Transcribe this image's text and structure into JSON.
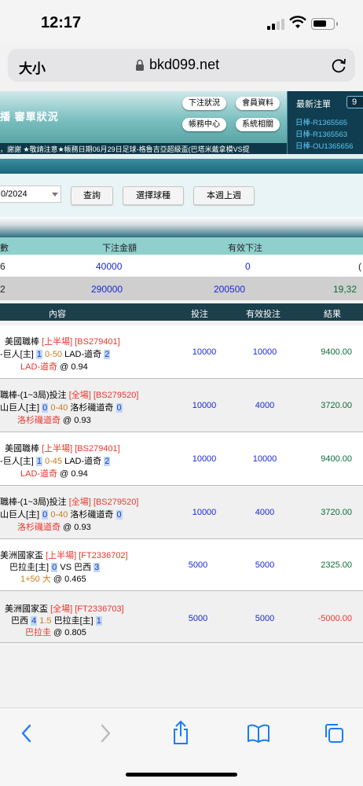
{
  "status": {
    "time": "12:17"
  },
  "browser": {
    "text_size": "大小",
    "url": "bkd099.net"
  },
  "header": {
    "title": "播  審單狀況",
    "buttons": [
      "下注狀況",
      "會員資料",
      "帳務中心",
      "系統相關"
    ],
    "marquee": "，謝謝 ★敬請注意★帳務日期06月29日足球-格魯吉亞超級盃(巴塔米戴拿模VS提",
    "latest_title": "最新注單",
    "latest_count": "9",
    "latest_items": [
      "日棒-R1365565",
      "日棒-R1365563",
      "日棒-OU1365656"
    ]
  },
  "filter": {
    "date_value": "0/2024",
    "buttons": [
      "查詢",
      "選擇球種",
      "本週上週"
    ]
  },
  "summary": {
    "headers": [
      "數",
      "下注金額",
      "有效下注"
    ],
    "row1": [
      "6",
      "40000",
      "0",
      "("
    ],
    "row2": [
      "2",
      "290000",
      "200500",
      "19,32"
    ]
  },
  "detail": {
    "headers": [
      "內容",
      "投注",
      "有效投注",
      "結果"
    ],
    "rows": [
      {
        "l1a": "美國職棒 ",
        "l1b": "[上半場] [BS279401]",
        "l2a": "-巨人[主] ",
        "l2h1": "1",
        "l2b": " 0-50",
        "l2c": " LAD-道奇 ",
        "l2h2": "2",
        "l3a": "LAD-道奇",
        "l3b": " @ 0.94",
        "bet": "10000",
        "valid": "10000",
        "result": "9400.00"
      },
      {
        "l1a": "職棒-(1~3局)投注 ",
        "l1b": "[全場] [BS279520]",
        "l2a": "山巨人[主] ",
        "l2h1": "0",
        "l2b": " 0-40",
        "l2c": " 洛杉磯道奇 ",
        "l2h2": "0",
        "l3a": "洛杉磯道奇",
        "l3b": " @ 0.93",
        "bet": "10000",
        "valid": "4000",
        "result": "3720.00"
      },
      {
        "l1a": "美國職棒 ",
        "l1b": "[上半場] [BS279401]",
        "l2a": "-巨人[主] ",
        "l2h1": "1",
        "l2b": " 0-45",
        "l2c": " LAD-道奇 ",
        "l2h2": "2",
        "l3a": "LAD-道奇",
        "l3b": " @ 0.94",
        "bet": "10000",
        "valid": "10000",
        "result": "9400.00"
      },
      {
        "l1a": "職棒-(1~3局)投注 ",
        "l1b": "[全場] [BS279520]",
        "l2a": "山巨人[主] ",
        "l2h1": "0",
        "l2b": " 0-40",
        "l2c": " 洛杉磯道奇 ",
        "l2h2": "0",
        "l3a": "洛杉磯道奇",
        "l3b": " @ 0.93",
        "bet": "10000",
        "valid": "4000",
        "result": "3720.00"
      },
      {
        "l1a": "美洲國家盃 ",
        "l1b": "[上半場] [FT2336702]",
        "l2a": "巴拉圭[主] ",
        "l2h1": "0",
        "l2b": "",
        "l2c": " VS 巴西 ",
        "l2h2": "3",
        "l3a": "1+50 大",
        "l3b": " @ 0.465",
        "bet": "5000",
        "valid": "5000",
        "result": "2325.00"
      },
      {
        "l1a": "美洲國家盃 ",
        "l1b": "[全場] [FT2336703]",
        "l2a": "巴西 ",
        "l2h1": "4",
        "l2b": " 1.5",
        "l2c": " 巴拉圭[主] ",
        "l2h2": "1",
        "l3a": "巴拉圭",
        "l3b": " @ 0.805",
        "bet": "5000",
        "valid": "5000",
        "result": "-5000.00"
      }
    ]
  }
}
